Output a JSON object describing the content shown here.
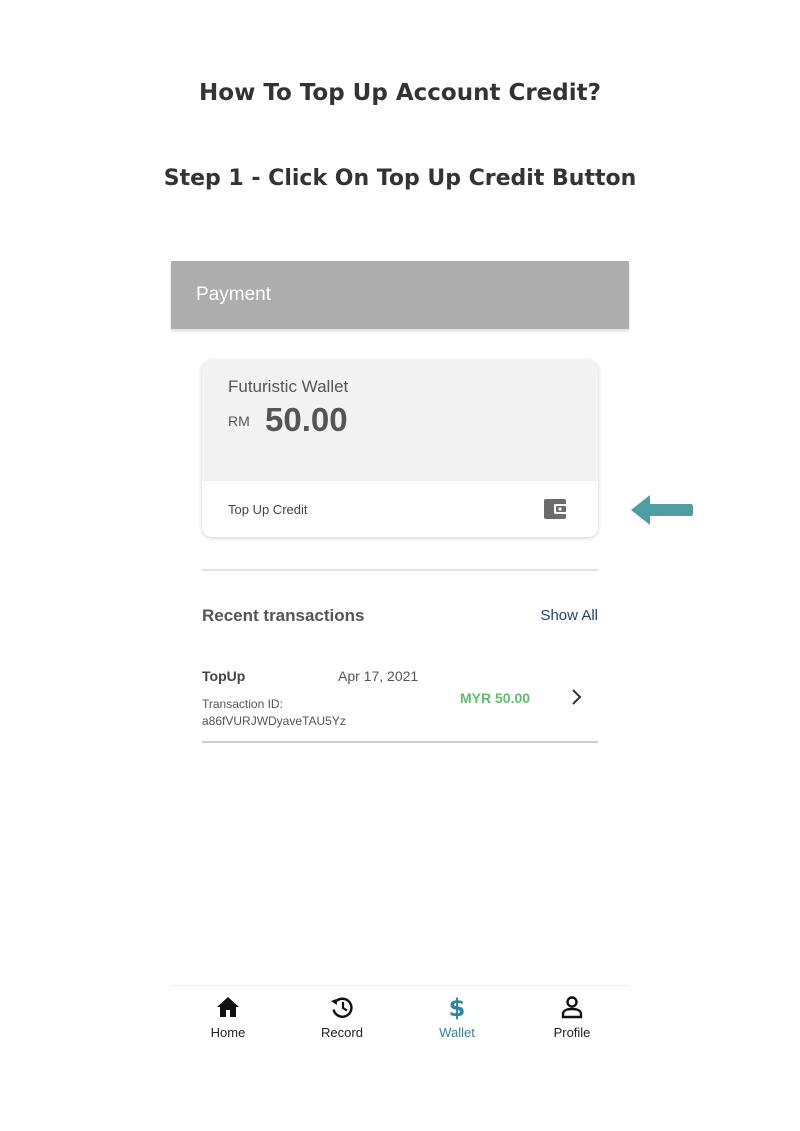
{
  "document": {
    "title": "How To Top Up Account Credit?",
    "step": "Step 1 -  Click On Top Up Credit Button"
  },
  "appbar": {
    "title": "Payment",
    "color": "#adadad"
  },
  "wallet": {
    "name": "Futuristic Wallet",
    "currency": "RM",
    "amount": "50.00",
    "topup_label": "Top Up Credit",
    "icon": "wallet-icon"
  },
  "pointer": {
    "icon": "arrow-left-icon",
    "color": "#4f9ea3"
  },
  "recent": {
    "title": "Recent transactions",
    "show_all": "Show All",
    "transactions": [
      {
        "type": "TopUp",
        "date": "Apr 17, 2021",
        "id_label": "Transaction ID:",
        "id": "a86fVURJWDyaveTAU5Yz",
        "amount": "MYR 50.00",
        "amount_color": "#5cbf6b"
      }
    ]
  },
  "nav": {
    "active_color": "#2b86a3",
    "items": [
      {
        "label": "Home",
        "icon": "home-icon"
      },
      {
        "label": "Record",
        "icon": "history-icon"
      },
      {
        "label": "Wallet",
        "icon": "dollar-icon",
        "active": true
      },
      {
        "label": "Profile",
        "icon": "person-icon"
      }
    ]
  }
}
